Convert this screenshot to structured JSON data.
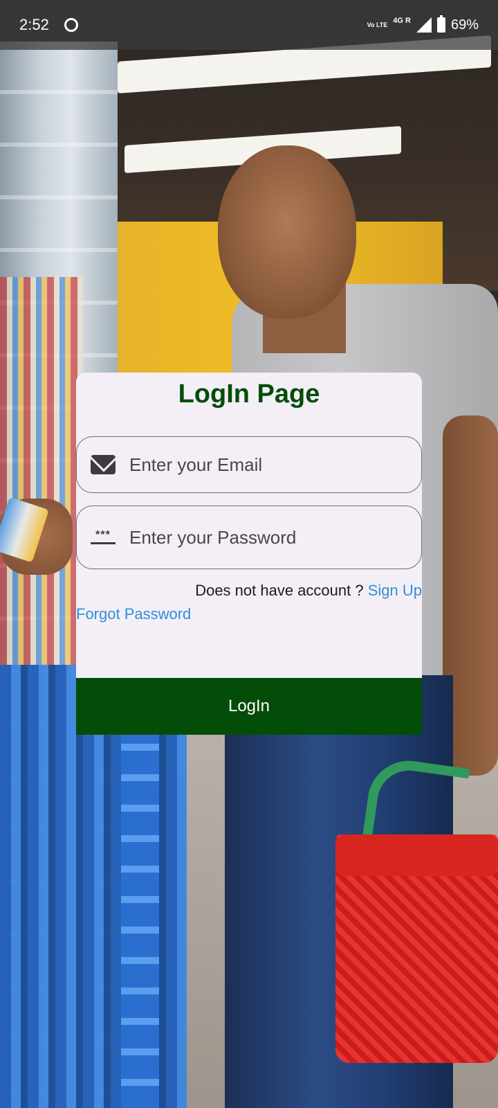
{
  "status_bar": {
    "time": "2:52",
    "volte": "Vo LTE",
    "network": "4G R",
    "battery": "69%"
  },
  "login": {
    "title": "LogIn Page",
    "email_placeholder": "Enter your Email",
    "password_placeholder": "Enter your Password",
    "password_icon_text": "***",
    "no_account_text": "Does not have account ?",
    "signup_link": "Sign Up",
    "forgot_link": "Forgot Password",
    "login_button": "LogIn"
  },
  "colors": {
    "primary": "#044d08",
    "card_bg": "#f4eff7",
    "link": "#2f8fd8"
  }
}
